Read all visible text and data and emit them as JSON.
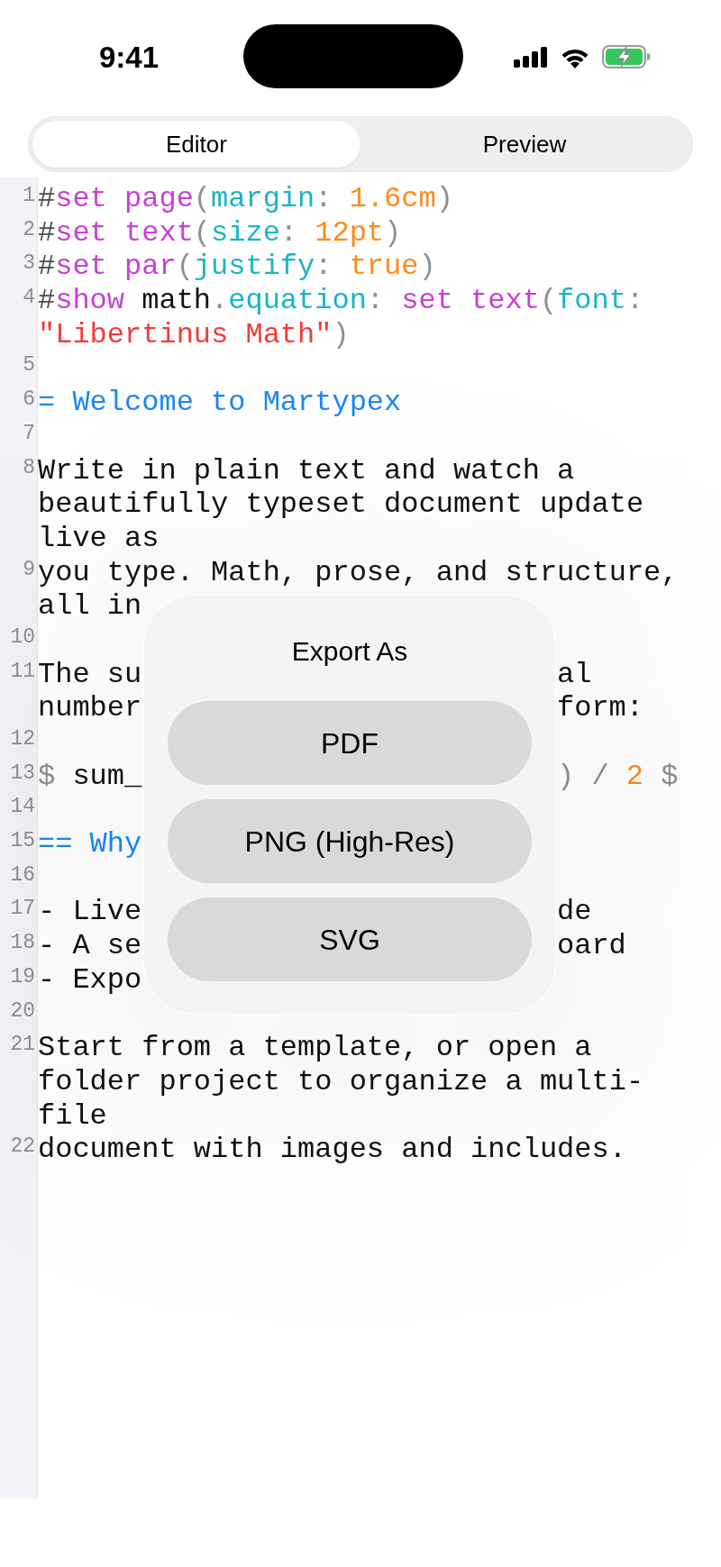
{
  "status_bar": {
    "time": "9:41"
  },
  "tabs": [
    {
      "label": "Editor",
      "selected": true
    },
    {
      "label": "Preview",
      "selected": false
    }
  ],
  "editor": {
    "lines": [
      {
        "number": "1",
        "rows": [
          {
            "tokens": [
              {
                "text": "#",
                "kind": "hash"
              },
              {
                "text": "set",
                "kind": "keyword"
              },
              {
                "text": " page",
                "kind": "keyword"
              },
              {
                "text": "(",
                "kind": "punct"
              },
              {
                "text": "margin",
                "kind": "param"
              },
              {
                "text": ": ",
                "kind": "punct"
              },
              {
                "text": "1.6cm",
                "kind": "number"
              },
              {
                "text": ")",
                "kind": "punct"
              }
            ]
          }
        ]
      },
      {
        "number": "2",
        "rows": [
          {
            "tokens": [
              {
                "text": "#",
                "kind": "hash"
              },
              {
                "text": "set",
                "kind": "keyword"
              },
              {
                "text": " text",
                "kind": "keyword"
              },
              {
                "text": "(",
                "kind": "punct"
              },
              {
                "text": "size",
                "kind": "param"
              },
              {
                "text": ": ",
                "kind": "punct"
              },
              {
                "text": "12pt",
                "kind": "number"
              },
              {
                "text": ")",
                "kind": "punct"
              }
            ]
          }
        ]
      },
      {
        "number": "3",
        "rows": [
          {
            "tokens": [
              {
                "text": "#",
                "kind": "hash"
              },
              {
                "text": "set",
                "kind": "keyword"
              },
              {
                "text": " par",
                "kind": "keyword"
              },
              {
                "text": "(",
                "kind": "punct"
              },
              {
                "text": "justify",
                "kind": "param"
              },
              {
                "text": ": ",
                "kind": "punct"
              },
              {
                "text": "true",
                "kind": "number"
              },
              {
                "text": ")",
                "kind": "punct"
              }
            ]
          }
        ]
      },
      {
        "number": "4",
        "rows": [
          {
            "tokens": [
              {
                "text": "#",
                "kind": "hash"
              },
              {
                "text": "show",
                "kind": "keyword"
              },
              {
                "text": " math",
                "kind": "plain"
              },
              {
                "text": ".",
                "kind": "punct"
              },
              {
                "text": "equation",
                "kind": "param"
              },
              {
                "text": ":",
                "kind": "punct"
              },
              {
                "text": " set",
                "kind": "keyword"
              },
              {
                "text": " text",
                "kind": "keyword"
              },
              {
                "text": "(",
                "kind": "punct"
              },
              {
                "text": "font",
                "kind": "param"
              },
              {
                "text": ":",
                "kind": "punct"
              }
            ]
          },
          {
            "tokens": [
              {
                "text": "\"Libertinus Math\"",
                "kind": "string"
              },
              {
                "text": ")",
                "kind": "punct"
              }
            ]
          }
        ]
      },
      {
        "number": "5"
      },
      {
        "number": "6",
        "rows": [
          {
            "tokens": [
              {
                "text": "= Welcome to Martypex",
                "kind": "heading"
              }
            ]
          }
        ]
      },
      {
        "number": "7"
      },
      {
        "number": "8",
        "rows": [
          {
            "tokens": [
              {
                "text": "Write in plain text and watch a",
                "kind": "plain"
              }
            ]
          },
          {
            "tokens": [
              {
                "text": "beautifully typeset document update",
                "kind": "plain"
              }
            ]
          },
          {
            "tokens": [
              {
                "text": "live as",
                "kind": "plain"
              }
            ]
          }
        ]
      },
      {
        "number": "9",
        "rows": [
          {
            "tokens": [
              {
                "text": "you type. Math, prose, and structure,",
                "kind": "plain"
              }
            ]
          },
          {
            "tokens": [
              {
                "text": "all in",
                "kind": "plain"
              }
            ]
          }
        ]
      },
      {
        "number": "10"
      },
      {
        "number": "11",
        "rows": [
          {
            "tokens": [
              {
                "text": "The su",
                "kind": "plain"
              }
            ],
            "right_tokens": [
              {
                "text": "al",
                "kind": "plain"
              }
            ]
          },
          {
            "tokens": [
              {
                "text": "number",
                "kind": "plain"
              }
            ],
            "right_tokens": [
              {
                "text": "form:",
                "kind": "plain"
              }
            ]
          }
        ]
      },
      {
        "number": "12"
      },
      {
        "number": "13",
        "rows": [
          {
            "tokens": [
              {
                "text": "$",
                "kind": "punct"
              },
              {
                "text": " sum_",
                "kind": "plain"
              }
            ],
            "right_tokens": [
              {
                "text": ")",
                "kind": "punct"
              },
              {
                "text": " / ",
                "kind": "punct"
              },
              {
                "text": "2",
                "kind": "number"
              },
              {
                "text": " $",
                "kind": "punct"
              }
            ]
          }
        ]
      },
      {
        "number": "14"
      },
      {
        "number": "15",
        "rows": [
          {
            "tokens": [
              {
                "text": "== Why",
                "kind": "heading"
              }
            ]
          }
        ]
      },
      {
        "number": "16"
      },
      {
        "number": "17",
        "rows": [
          {
            "tokens": [
              {
                "text": "- Live",
                "kind": "plain"
              }
            ],
            "right_tokens": [
              {
                "text": "de",
                "kind": "plain"
              }
            ]
          }
        ]
      },
      {
        "number": "18",
        "rows": [
          {
            "tokens": [
              {
                "text": "- A se",
                "kind": "plain"
              }
            ],
            "right_tokens": [
              {
                "text": "oard",
                "kind": "plain"
              }
            ]
          }
        ]
      },
      {
        "number": "19",
        "rows": [
          {
            "tokens": [
              {
                "text": "- Expo",
                "kind": "plain"
              }
            ]
          }
        ]
      },
      {
        "number": "20"
      },
      {
        "number": "21",
        "rows": [
          {
            "tokens": [
              {
                "text": "Start from a template, or open a",
                "kind": "plain"
              }
            ]
          },
          {
            "tokens": [
              {
                "text": "folder project to organize a multi-",
                "kind": "plain"
              }
            ]
          },
          {
            "tokens": [
              {
                "text": "file",
                "kind": "plain"
              }
            ]
          }
        ]
      },
      {
        "number": "22",
        "rows": [
          {
            "tokens": [
              {
                "text": "document with images and includes.",
                "kind": "plain"
              }
            ]
          }
        ]
      }
    ]
  },
  "export_dialog": {
    "title": "Export As",
    "options": [
      "PDF",
      "PNG (High-Res)",
      "SVG"
    ]
  }
}
